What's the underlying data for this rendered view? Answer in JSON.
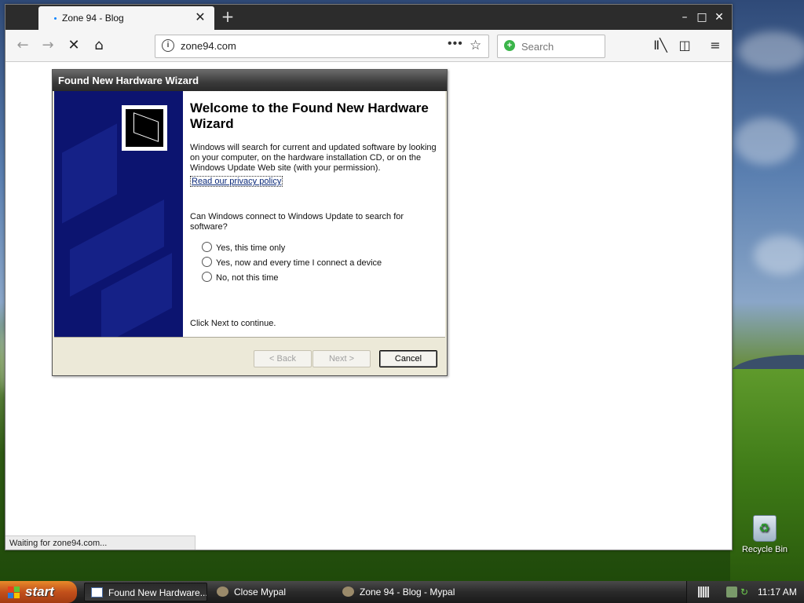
{
  "browser": {
    "tab_title": "Zone 94 - Blog",
    "url": "zone94.com",
    "search_placeholder": "Search",
    "status_text": "Waiting for zone94.com..."
  },
  "wizard": {
    "title": "Found New Hardware Wizard",
    "heading": "Welcome to the Found New Hardware Wizard",
    "intro": "Windows will search for current and updated software by looking on your computer, on the hardware installation CD, or on the Windows Update Web site (with your permission).",
    "privacy_link": "Read our privacy policy",
    "question": "Can Windows connect to Windows Update to search for software?",
    "options": [
      {
        "label": "Yes, this time only"
      },
      {
        "label": "Yes, now and every time I connect a device"
      },
      {
        "label": "No, not this time"
      }
    ],
    "continue_text": "Click Next to continue.",
    "back_label": "< Back",
    "next_label": "Next >",
    "cancel_label": "Cancel"
  },
  "desktop": {
    "recycle_bin_label": "Recycle Bin"
  },
  "taskbar": {
    "start_label": "start",
    "items": [
      {
        "label": "Found New Hardware...",
        "active": true
      },
      {
        "label": "Close Mypal",
        "active": false
      },
      {
        "label": "Zone 94 - Blog - Mypal",
        "active": false
      }
    ],
    "clock": "11:17 AM"
  },
  "colors": {
    "wizard_side": "#0c1470",
    "start_button": "#c2501b",
    "link": "#0b2a7a"
  }
}
